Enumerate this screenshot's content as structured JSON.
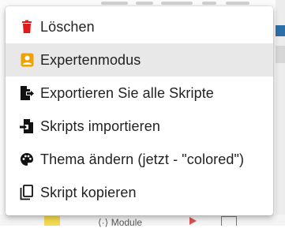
{
  "menu": {
    "items": [
      {
        "label": "Löschen",
        "icon": "trash-icon",
        "color": "#e01b1b"
      },
      {
        "label": "Expertenmodus",
        "icon": "expert-badge-icon",
        "color": "#f0a200",
        "highlighted": true
      },
      {
        "label": "Exportieren Sie alle Skripte",
        "icon": "file-export-icon",
        "color": "#111111"
      },
      {
        "label": "Skripts importieren",
        "icon": "file-import-icon",
        "color": "#111111"
      },
      {
        "label": "Thema ändern (jetzt - \"colored\")",
        "icon": "palette-icon",
        "color": "#111111"
      },
      {
        "label": "Skript kopieren",
        "icon": "copy-icon",
        "color": "#111111"
      }
    ]
  },
  "background": {
    "module_label": "⟨·⟩ Module"
  }
}
